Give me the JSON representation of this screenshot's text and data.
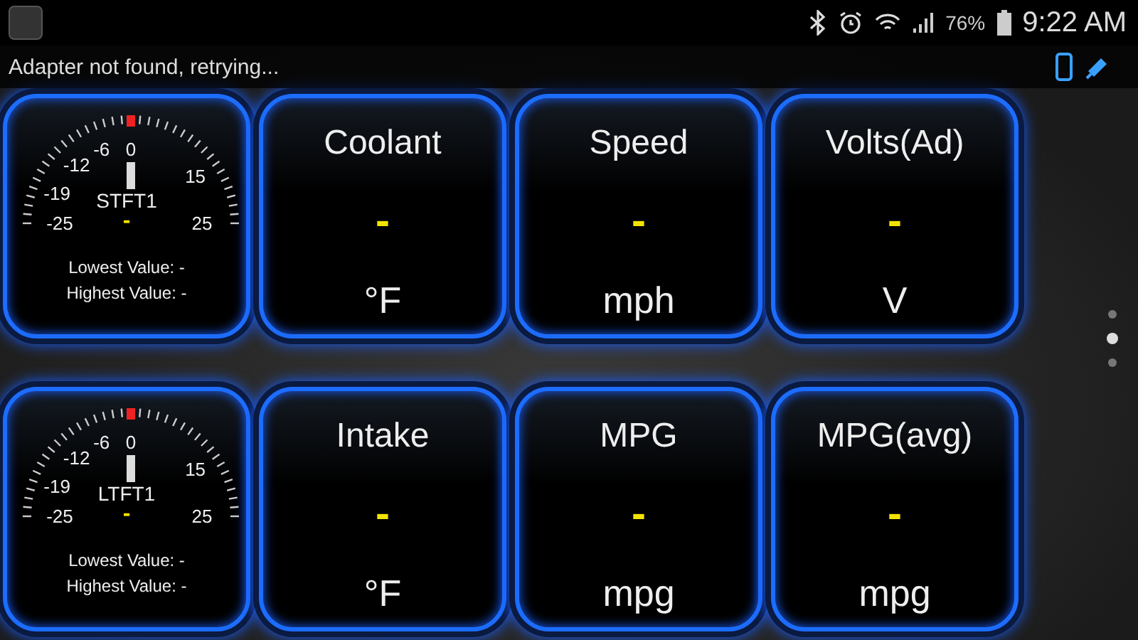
{
  "status_bar": {
    "battery": "76%",
    "time": "9:22 AM"
  },
  "notification": {
    "text": "Adapter not found, retrying..."
  },
  "rows": [
    {
      "cards": [
        {
          "kind": "dial",
          "ticks": [
            "-25",
            "-19",
            "-12",
            "-6",
            "0",
            "15",
            "25"
          ],
          "label": "STFT1",
          "value": "-",
          "lowest": "Lowest Value: -",
          "highest": "Highest Value: -"
        },
        {
          "kind": "digital",
          "title": "Coolant",
          "value": "-",
          "unit": "°F"
        },
        {
          "kind": "digital",
          "title": "Speed",
          "value": "-",
          "unit": "mph"
        },
        {
          "kind": "digital",
          "title": "Volts(Ad)",
          "value": "-",
          "unit": "V"
        }
      ]
    },
    {
      "cards": [
        {
          "kind": "dial",
          "ticks": [
            "-25",
            "-19",
            "-12",
            "-6",
            "0",
            "15",
            "25"
          ],
          "label": "LTFT1",
          "value": "-",
          "lowest": "Lowest Value: -",
          "highest": "Highest Value: -"
        },
        {
          "kind": "digital",
          "title": "Intake",
          "value": "-",
          "unit": "°F"
        },
        {
          "kind": "digital",
          "title": "MPG",
          "value": "-",
          "unit": "mpg"
        },
        {
          "kind": "digital",
          "title": "MPG(avg)",
          "value": "-",
          "unit": "mpg"
        }
      ]
    }
  ],
  "pages": [
    {
      "selected": false
    },
    {
      "selected": true
    },
    {
      "selected": false
    }
  ]
}
